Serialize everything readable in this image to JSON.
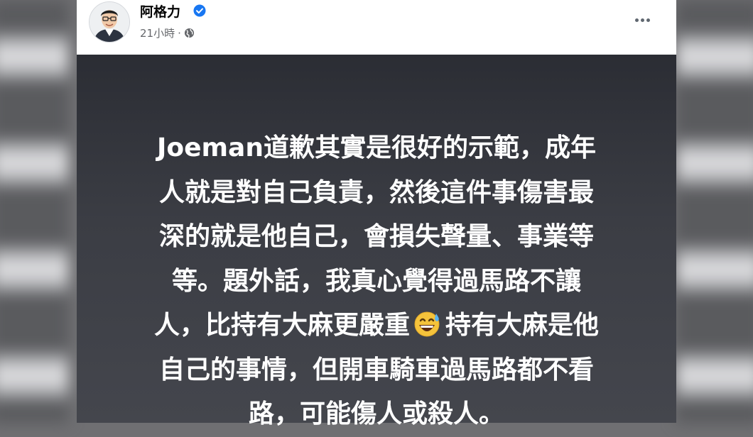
{
  "post": {
    "author_name": "阿格力",
    "verified_icon": "verified-badge-icon",
    "timestamp": "21小時",
    "separator": "·",
    "audience_icon": "globe-icon",
    "more_icon": "more-options-icon",
    "colors": {
      "card_background_top": "#2b2d34",
      "card_background_bottom": "#44464d",
      "card_text": "#ffffff",
      "verified": "#1877f2",
      "meta_text": "#65676b"
    },
    "text_card": {
      "lines": [
        "Joeman道歉其實是很好的示範，成年",
        "人就是對自己負責，然後這件事傷害最",
        "深的就是他自己，會損失聲量、事業等",
        "等。題外話，我真心覺得過馬路不讓",
        "人，比持有大麻更嚴重",
        "持有大麻是他",
        "自己的事情，但開車騎車過馬路都不看",
        "路，可能傷人或殺人。"
      ],
      "emoji": "grinning-face-with-sweat-emoji"
    }
  }
}
